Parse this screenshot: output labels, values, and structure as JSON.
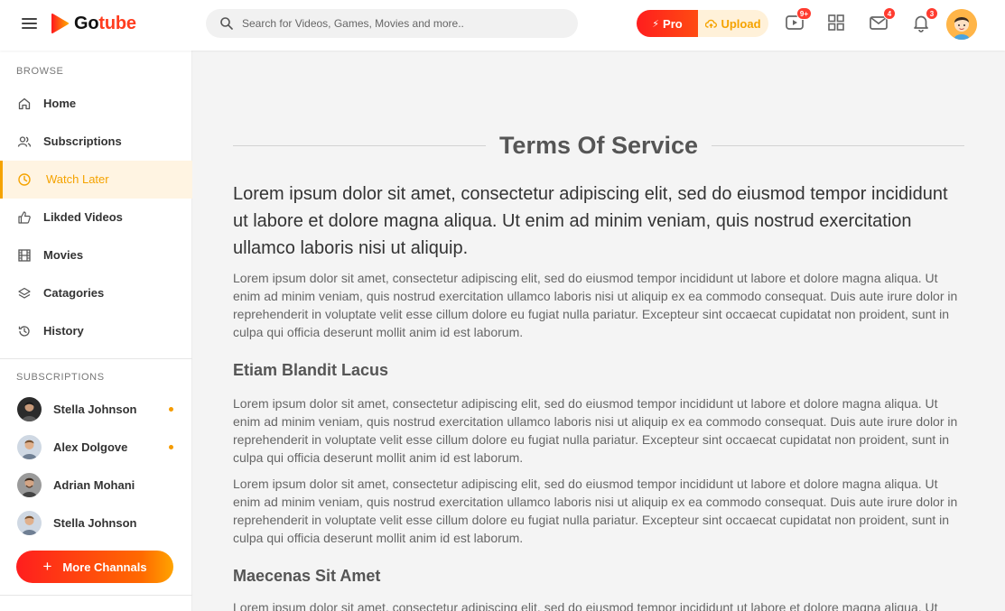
{
  "brand": {
    "name_part1": "Go",
    "name_part2": "tube",
    "accent_color": "#ff3d1f",
    "highlight_color": "#f5a300"
  },
  "header": {
    "search_placeholder": "Search for Videos, Games, Movies and more..",
    "pro_label": "Pro",
    "upload_label": "Upload",
    "video_badge": "9+",
    "mail_badge": "4",
    "notification_badge": "3"
  },
  "sidebar": {
    "browse_label": "BROWSE",
    "items": [
      {
        "label": "Home",
        "icon": "home-icon"
      },
      {
        "label": "Subscriptions",
        "icon": "users-icon"
      },
      {
        "label": "Watch Later",
        "icon": "clock-icon",
        "active": true
      },
      {
        "label": "Likded Videos",
        "icon": "thumbs-up-icon"
      },
      {
        "label": "Movies",
        "icon": "film-icon"
      },
      {
        "label": "Catagories",
        "icon": "layers-icon"
      },
      {
        "label": "History",
        "icon": "history-icon"
      }
    ],
    "subscriptions_label": "SUBSCRIPTIONS",
    "subscriptions": [
      {
        "name": "Stella Johnson",
        "online": true
      },
      {
        "name": "Alex Dolgove",
        "online": true
      },
      {
        "name": "Adrian Mohani",
        "online": false
      },
      {
        "name": "Stella Johnson",
        "online": false
      }
    ],
    "more_button": "More Channals"
  },
  "main": {
    "title": "Terms Of Service",
    "lead": "Lorem ipsum dolor sit amet, consectetur adipiscing elit, sed do eiusmod tempor incididunt ut labore et dolore magna aliqua. Ut enim ad minim veniam, quis nostrud exercitation ullamco laboris nisi ut aliquip.",
    "para1": "Lorem ipsum dolor sit amet, consectetur adipiscing elit, sed do eiusmod tempor incididunt ut labore et dolore magna aliqua. Ut enim ad minim veniam, quis nostrud exercitation ullamco laboris nisi ut aliquip ex ea commodo consequat. Duis aute irure dolor in reprehenderit in voluptate velit esse cillum dolore eu fugiat nulla pariatur. Excepteur sint occaecat cupidatat non proident, sunt in culpa qui officia deserunt mollit anim id est laborum.",
    "heading2": "Etiam Blandit Lacus",
    "para2": "Lorem ipsum dolor sit amet, consectetur adipiscing elit, sed do eiusmod tempor incididunt ut labore et dolore magna aliqua. Ut enim ad minim veniam, quis nostrud exercitation ullamco laboris nisi ut aliquip ex ea commodo consequat. Duis aute irure dolor in reprehenderit in voluptate velit esse cillum dolore eu fugiat nulla pariatur. Excepteur sint occaecat cupidatat non proident, sunt in culpa qui officia deserunt mollit anim id est laborum.",
    "para3": "Lorem ipsum dolor sit amet, consectetur adipiscing elit, sed do eiusmod tempor incididunt ut labore et dolore magna aliqua. Ut enim ad minim veniam, quis nostrud exercitation ullamco laboris nisi ut aliquip ex ea commodo consequat. Duis aute irure dolor in reprehenderit in voluptate velit esse cillum dolore eu fugiat nulla pariatur. Excepteur sint occaecat cupidatat non proident, sunt in culpa qui officia deserunt mollit anim id est laborum.",
    "heading3": "Maecenas Sit Amet",
    "para4": "Lorem ipsum dolor sit amet, consectetur adipiscing elit, sed do eiusmod tempor incididunt ut labore et dolore magna aliqua. Ut"
  }
}
